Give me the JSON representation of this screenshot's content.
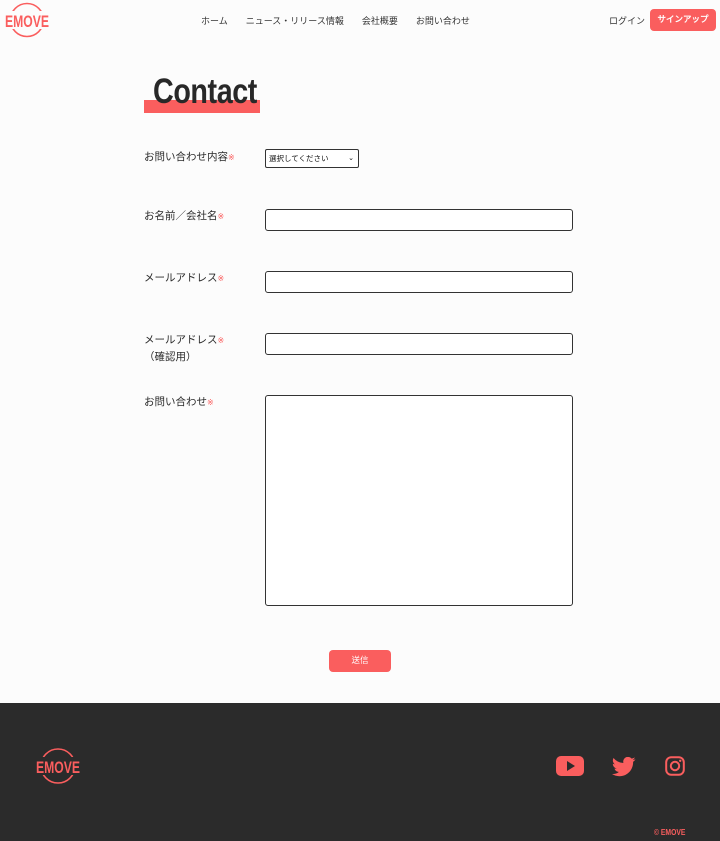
{
  "brand": {
    "name": "EMOVE",
    "accent": "#fa5e5e",
    "dark": "#2b2b2b"
  },
  "nav": {
    "items": [
      "ホーム",
      "ニュース・リリース情報",
      "会社概要",
      "お問い合わせ"
    ],
    "login": "ログイン",
    "signup": "サインアップ"
  },
  "page": {
    "title": "Contact"
  },
  "form": {
    "required_mark": "※",
    "inquiry_type_label": "お問い合わせ内容",
    "inquiry_type_selected": "選択してください",
    "name_label": "お名前／会社名",
    "email_label": "メールアドレス",
    "email_confirm_label": "メールアドレス",
    "email_confirm_sub": "（確認用）",
    "message_label": "お問い合わせ",
    "submit": "送信"
  },
  "footer": {
    "social": [
      "youtube-icon",
      "twitter-icon",
      "instagram-icon"
    ],
    "copyright": "© EMOVE"
  }
}
